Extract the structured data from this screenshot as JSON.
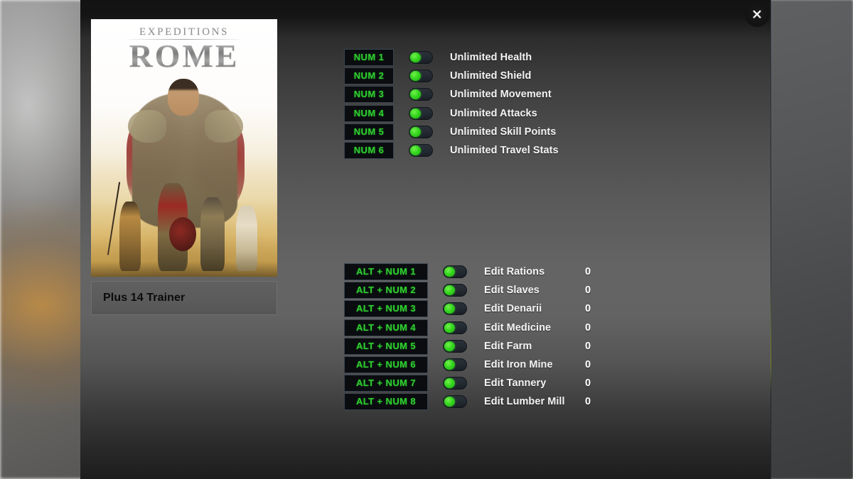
{
  "window": {
    "close_label": "✕",
    "close_icon": "close-icon"
  },
  "game": {
    "cover_title_top": "EXPEDITIONS",
    "cover_title_main": "ROME",
    "trainer_name": "Plus 14 Trainer"
  },
  "colors": {
    "hotkey_text": "#2fcf2f",
    "hotkey_bg": "#0a0c10",
    "toggle_knob": "#33d41e",
    "panel_top": "#151515",
    "panel_mid": "#646464",
    "name_bar": "#5a5a5a",
    "label_text": "#f4f4f4"
  },
  "cheats": [
    {
      "hotkey": "NUM 1",
      "label": "Unlimited Health",
      "toggle": "on"
    },
    {
      "hotkey": "NUM 2",
      "label": "Unlimited Shield",
      "toggle": "on"
    },
    {
      "hotkey": "NUM 3",
      "label": "Unlimited Movement",
      "toggle": "on"
    },
    {
      "hotkey": "NUM 4",
      "label": "Unlimited Attacks",
      "toggle": "on"
    },
    {
      "hotkey": "NUM 5",
      "label": "Unlimited Skill Points",
      "toggle": "on"
    },
    {
      "hotkey": "NUM 6",
      "label": "Unlimited Travel Stats",
      "toggle": "on"
    }
  ],
  "editors": [
    {
      "hotkey": "ALT + NUM 1",
      "label": "Edit Rations",
      "toggle": "on",
      "value": "0"
    },
    {
      "hotkey": "ALT + NUM 2",
      "label": "Edit Slaves",
      "toggle": "on",
      "value": "0"
    },
    {
      "hotkey": "ALT + NUM 3",
      "label": "Edit Denarii",
      "toggle": "on",
      "value": "0"
    },
    {
      "hotkey": "ALT + NUM 4",
      "label": "Edit Medicine",
      "toggle": "on",
      "value": "0"
    },
    {
      "hotkey": "ALT + NUM 5",
      "label": "Edit Farm",
      "toggle": "on",
      "value": "0"
    },
    {
      "hotkey": "ALT + NUM 6",
      "label": "Edit Iron Mine",
      "toggle": "on",
      "value": "0"
    },
    {
      "hotkey": "ALT + NUM 7",
      "label": "Edit Tannery",
      "toggle": "on",
      "value": "0"
    },
    {
      "hotkey": "ALT + NUM 8",
      "label": "Edit Lumber Mill",
      "toggle": "on",
      "value": "0"
    }
  ]
}
